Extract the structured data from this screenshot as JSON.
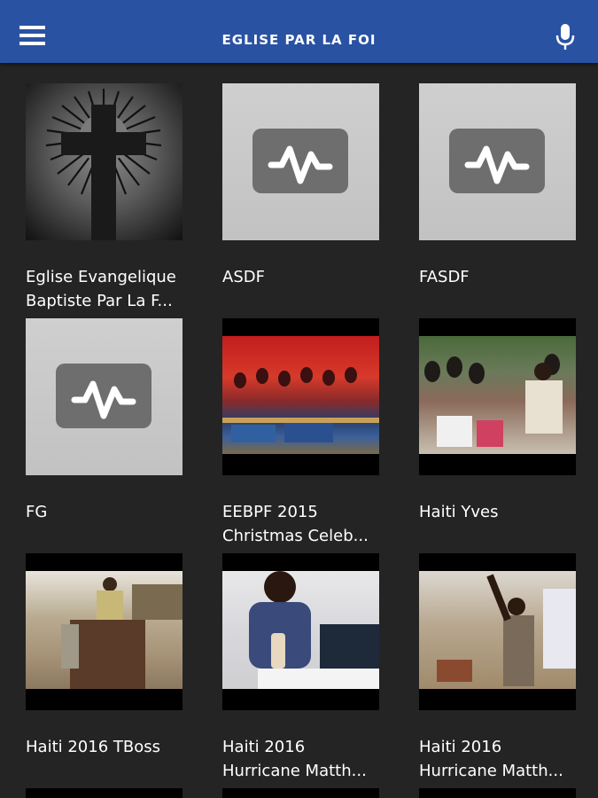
{
  "header": {
    "title": "EGLISE PAR LA FOI",
    "menu_icon": "hamburger-menu-icon",
    "mic_icon": "microphone-icon",
    "color": "#2a52a3"
  },
  "items": [
    {
      "caption_line1": "Eglise Evangelique",
      "caption_line2": "Baptiste Par La F..."
    },
    {
      "caption_line1": "ASDF",
      "caption_line2": ""
    },
    {
      "caption_line1": "FASDF",
      "caption_line2": ""
    },
    {
      "caption_line1": "FG",
      "caption_line2": ""
    },
    {
      "caption_line1": "EEBPF 2015",
      "caption_line2": "Christmas Celeb..."
    },
    {
      "caption_line1": "Haiti Yves",
      "caption_line2": ""
    },
    {
      "caption_line1": "Haiti 2016 TBoss",
      "caption_line2": ""
    },
    {
      "caption_line1": "Haiti 2016",
      "caption_line2": "Hurricane Matth..."
    },
    {
      "caption_line1": "Haiti 2016",
      "caption_line2": "Hurricane Matth..."
    }
  ]
}
